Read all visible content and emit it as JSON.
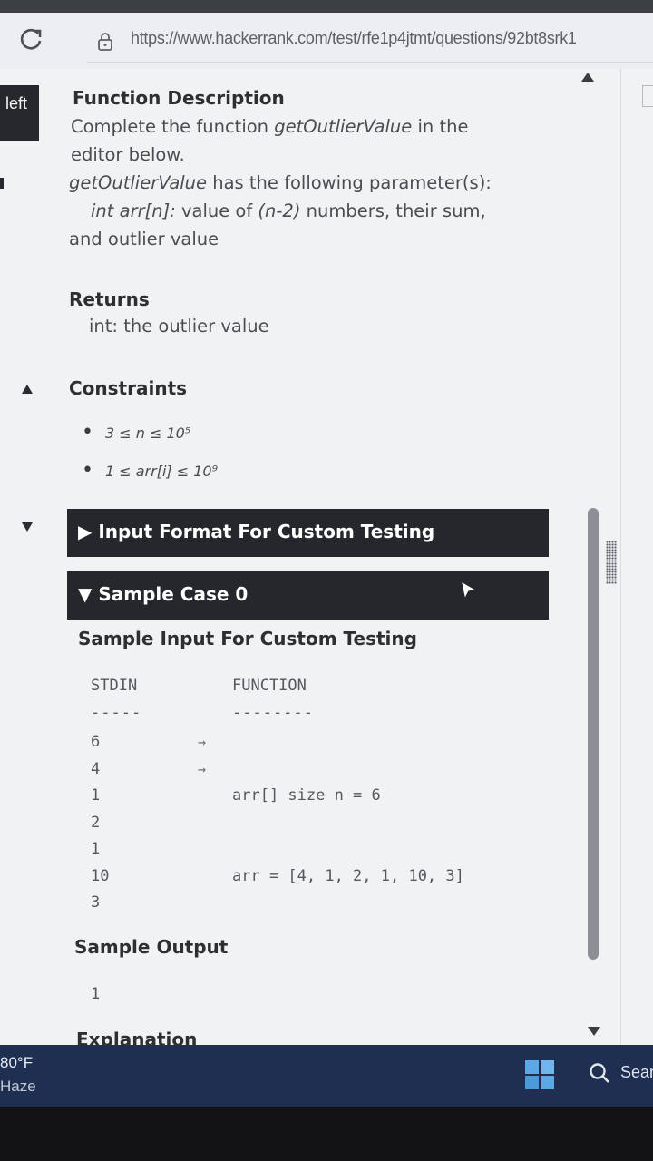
{
  "browser": {
    "url": "https://www.hackerrank.com/test/rfe1p4jtmt/questions/92bt8srk1"
  },
  "left_panel": {
    "tab_label": "left"
  },
  "problem": {
    "function_description_title": "Function Description",
    "intro_prefix": "Complete the function ",
    "function_name": "getOutlierValue",
    "intro_suffix": " in the editor below.",
    "params_suffix": " has the following parameter(s):",
    "param_signature": "int arr[n]:",
    "param_desc": " value of ",
    "param_expr": "(n-2)",
    "param_desc2": " numbers, their sum,",
    "param_desc3": "and outlier value",
    "returns_title": "Returns",
    "returns_text": "int: the outlier value",
    "constraints_title": "Constraints",
    "constraints": [
      "3 ≤ n ≤ 10⁵",
      "1 ≤ arr[i] ≤ 10⁹"
    ],
    "input_format_bar": "▶ Input Format For Custom Testing",
    "sample_case_bar": "▼ Sample Case 0",
    "sample_input_title": "Sample Input For Custom Testing",
    "stdin_header": "STDIN",
    "function_header": "FUNCTION",
    "stdin_dashes": "-----",
    "function_dashes": "--------",
    "stdin_values": [
      "6",
      "4",
      "1",
      "2",
      "1",
      "10",
      "3"
    ],
    "arrow": "→",
    "function_lines": [
      "arr[] size n = 6",
      "arr = [4, 1, 2, 1, 10, 3]"
    ],
    "sample_output_title": "Sample Output",
    "sample_output_value": "1",
    "explanation_title": "Explanation"
  },
  "taskbar": {
    "temperature": "80°F",
    "condition": "Haze",
    "search_label": "Search"
  },
  "colors": {
    "dark_bar": "#25272c",
    "page_bg": "#f1f2f4",
    "taskbar": "#1e2f52"
  }
}
